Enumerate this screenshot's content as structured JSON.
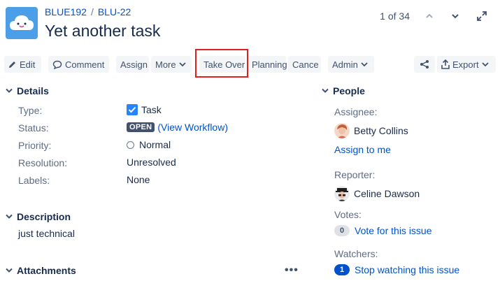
{
  "breadcrumb": {
    "project": "BLUE192",
    "separator": "/",
    "issue_key": "BLU-22"
  },
  "issue": {
    "title": "Yet another task"
  },
  "pager": {
    "position": "1 of 34"
  },
  "toolbar": {
    "edit": "Edit",
    "comment": "Comment",
    "assign": "Assign",
    "more": "More",
    "take_over": "Take Over",
    "planning": "Planning",
    "cancel": "Cance",
    "admin": "Admin",
    "export": "Export"
  },
  "details": {
    "heading": "Details",
    "type_label": "Type:",
    "type_value": "Task",
    "status_label": "Status:",
    "status_value": "OPEN",
    "workflow_link": "(View Workflow)",
    "priority_label": "Priority:",
    "priority_value": "Normal",
    "resolution_label": "Resolution:",
    "resolution_value": "Unresolved",
    "labels_label": "Labels:",
    "labels_value": "None"
  },
  "description": {
    "heading": "Description",
    "text": "just technical"
  },
  "attachments": {
    "heading": "Attachments",
    "menu": "•••"
  },
  "people": {
    "heading": "People",
    "assignee_label": "Assignee:",
    "assignee_name": "Betty Collins",
    "assign_to_me": "Assign to me",
    "reporter_label": "Reporter:",
    "reporter_name": "Celine Dawson",
    "votes_label": "Votes:",
    "votes_count": "0",
    "vote_link": "Vote for this issue",
    "watchers_label": "Watchers:",
    "watchers_count": "1",
    "watch_link": "Stop watching this issue"
  },
  "colors": {
    "link": "#0052cc",
    "highlight": "#e02020",
    "lozenge": "#42526e",
    "project_avatar": "#4a9fe8"
  }
}
